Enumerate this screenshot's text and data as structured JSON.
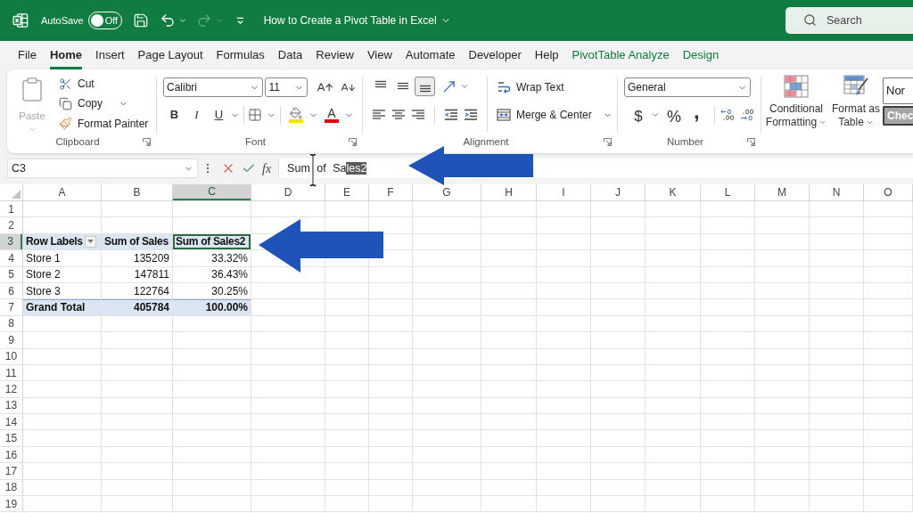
{
  "title_bar": {
    "autosave": {
      "label": "AutoSave",
      "toggle_text": "Off",
      "on": false
    },
    "redo": {
      "disabled": true
    },
    "document_title": "How to Create a Pivot Table in Excel",
    "search": {
      "placeholder": "Search"
    }
  },
  "menu_tabs": [
    {
      "label": "File",
      "kind": "standard",
      "selected": false
    },
    {
      "label": "Home",
      "kind": "standard",
      "selected": true
    },
    {
      "label": "Insert",
      "kind": "standard",
      "selected": false
    },
    {
      "label": "Page Layout",
      "kind": "standard",
      "selected": false
    },
    {
      "label": "Formulas",
      "kind": "standard",
      "selected": false
    },
    {
      "label": "Data",
      "kind": "standard",
      "selected": false
    },
    {
      "label": "Review",
      "kind": "standard",
      "selected": false
    },
    {
      "label": "View",
      "kind": "standard",
      "selected": false
    },
    {
      "label": "Automate",
      "kind": "standard",
      "selected": false
    },
    {
      "label": "Developer",
      "kind": "standard",
      "selected": false
    },
    {
      "label": "Help",
      "kind": "standard",
      "selected": false
    },
    {
      "label": "PivotTable Analyze",
      "kind": "contextual",
      "selected": false
    },
    {
      "label": "Design",
      "kind": "contextual",
      "selected": false
    }
  ],
  "ribbon": {
    "clipboard": {
      "title": "Clipboard",
      "paste": {
        "label": "Paste",
        "disabled": true
      },
      "commands": [
        {
          "kind": "cut",
          "label": "Cut"
        },
        {
          "kind": "copy",
          "label": "Copy"
        },
        {
          "kind": "format_painter",
          "label": "Format Painter"
        }
      ]
    },
    "font": {
      "title": "Font",
      "font_name": "Calibri",
      "font_size": "11",
      "style_buttons": [
        {
          "kind": "bold",
          "label": "B"
        },
        {
          "kind": "italic",
          "label": "I"
        },
        {
          "kind": "underline",
          "label": "U"
        }
      ],
      "font_color_label": "A"
    },
    "alignment": {
      "title": "Alignment",
      "vertical": [
        {
          "kind": "top",
          "selected": false
        },
        {
          "kind": "middle",
          "selected": false
        },
        {
          "kind": "bottom",
          "selected": true
        }
      ],
      "wrap_text": "Wrap Text",
      "merge_center": "Merge & Center"
    },
    "number": {
      "title": "Number",
      "format": "General",
      "buttons": [
        {
          "kind": "currency",
          "label": "$"
        },
        {
          "kind": "percent",
          "label": "%"
        },
        {
          "kind": "comma",
          "label": ","
        }
      ]
    },
    "styles": {
      "conditional_formatting": "Conditional Formatting",
      "format_as_table": "Format as Table",
      "cell_styles": [
        {
          "kind": "normal",
          "label": "Nor"
        },
        {
          "kind": "check",
          "label": "Chec"
        }
      ]
    }
  },
  "formula_bar": {
    "name_box": "C3",
    "function_label": "fx",
    "formula": {
      "text": "Sum of Sa",
      "selected_text": "les2"
    }
  },
  "columns": [
    {
      "label": "A",
      "selected": false
    },
    {
      "label": "B",
      "selected": false
    },
    {
      "label": "C",
      "selected": true
    },
    {
      "label": "D",
      "selected": false
    },
    {
      "label": "E",
      "selected": false
    },
    {
      "label": "F",
      "selected": false
    },
    {
      "label": "G",
      "selected": false
    },
    {
      "label": "H",
      "selected": false
    },
    {
      "label": "I",
      "selected": false
    },
    {
      "label": "J",
      "selected": false
    },
    {
      "label": "K",
      "selected": false
    },
    {
      "label": "L",
      "selected": false
    },
    {
      "label": "M",
      "selected": false
    },
    {
      "label": "N",
      "selected": false
    },
    {
      "label": "O",
      "selected": false
    }
  ],
  "rows": [
    {
      "label": "1",
      "selected": false
    },
    {
      "label": "2",
      "selected": false
    },
    {
      "label": "3",
      "selected": true
    },
    {
      "label": "4",
      "selected": false
    },
    {
      "label": "5",
      "selected": false
    },
    {
      "label": "6",
      "selected": false
    },
    {
      "label": "7",
      "selected": false
    },
    {
      "label": "8",
      "selected": false
    },
    {
      "label": "9",
      "selected": false
    },
    {
      "label": "10",
      "selected": false
    },
    {
      "label": "11",
      "selected": false
    },
    {
      "label": "12",
      "selected": false
    },
    {
      "label": "13",
      "selected": false
    },
    {
      "label": "14",
      "selected": false
    },
    {
      "label": "15",
      "selected": false
    },
    {
      "label": "16",
      "selected": false
    },
    {
      "label": "17",
      "selected": false
    },
    {
      "label": "18",
      "selected": false
    },
    {
      "label": "19",
      "selected": false
    }
  ],
  "pivot_table": {
    "header": {
      "row_labels": "Row Labels",
      "values": [
        "Sum of Sales",
        "Sum of Sales2"
      ]
    },
    "rows": [
      {
        "label": "Store 1",
        "values": [
          "135209",
          "33.32%"
        ]
      },
      {
        "label": "Store 2",
        "values": [
          "147811",
          "36.43%"
        ]
      },
      {
        "label": "Store 3",
        "values": [
          "122764",
          "30.25%"
        ]
      }
    ],
    "grand_total": {
      "label": "Grand Total",
      "values": [
        "405784",
        "100.00%"
      ]
    }
  }
}
